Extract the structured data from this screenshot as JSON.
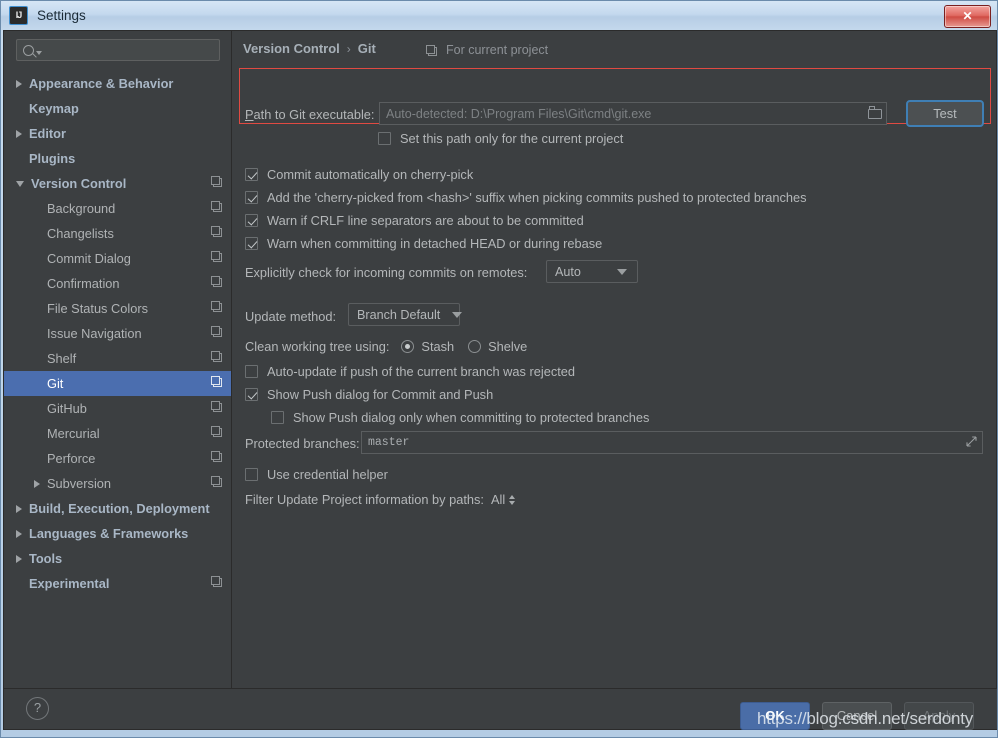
{
  "window": {
    "title": "Settings",
    "app_icon": "IJ",
    "close_label": "✕"
  },
  "sidebar": {
    "search": {
      "value": "",
      "placeholder": ""
    },
    "items": [
      {
        "label": "Appearance & Behavior",
        "level": 0,
        "arrow": "closed",
        "copy": false,
        "selected": false
      },
      {
        "label": "Keymap",
        "level": 0,
        "arrow": "none",
        "copy": false,
        "selected": false
      },
      {
        "label": "Editor",
        "level": 0,
        "arrow": "closed",
        "copy": false,
        "selected": false
      },
      {
        "label": "Plugins",
        "level": 0,
        "arrow": "none",
        "copy": false,
        "selected": false
      },
      {
        "label": "Version Control",
        "level": 0,
        "arrow": "open",
        "copy": true,
        "selected": false
      },
      {
        "label": "Background",
        "level": 1,
        "arrow": "none",
        "copy": true,
        "selected": false
      },
      {
        "label": "Changelists",
        "level": 1,
        "arrow": "none",
        "copy": true,
        "selected": false
      },
      {
        "label": "Commit Dialog",
        "level": 1,
        "arrow": "none",
        "copy": true,
        "selected": false
      },
      {
        "label": "Confirmation",
        "level": 1,
        "arrow": "none",
        "copy": true,
        "selected": false
      },
      {
        "label": "File Status Colors",
        "level": 1,
        "arrow": "none",
        "copy": true,
        "selected": false
      },
      {
        "label": "Issue Navigation",
        "level": 1,
        "arrow": "none",
        "copy": true,
        "selected": false
      },
      {
        "label": "Shelf",
        "level": 1,
        "arrow": "none",
        "copy": true,
        "selected": false
      },
      {
        "label": "Git",
        "level": 1,
        "arrow": "none",
        "copy": true,
        "selected": true
      },
      {
        "label": "GitHub",
        "level": 1,
        "arrow": "none",
        "copy": true,
        "selected": false
      },
      {
        "label": "Mercurial",
        "level": 1,
        "arrow": "none",
        "copy": true,
        "selected": false
      },
      {
        "label": "Perforce",
        "level": 1,
        "arrow": "none",
        "copy": true,
        "selected": false
      },
      {
        "label": "Subversion",
        "level": 1,
        "arrow": "closed",
        "copy": true,
        "selected": false
      },
      {
        "label": "Build, Execution, Deployment",
        "level": 0,
        "arrow": "closed",
        "copy": false,
        "selected": false
      },
      {
        "label": "Languages & Frameworks",
        "level": 0,
        "arrow": "closed",
        "copy": false,
        "selected": false
      },
      {
        "label": "Tools",
        "level": 0,
        "arrow": "closed",
        "copy": false,
        "selected": false
      },
      {
        "label": "Experimental",
        "level": 0,
        "arrow": "none",
        "copy": true,
        "selected": false
      }
    ]
  },
  "breadcrumb": {
    "root": "Version Control",
    "separator": "›",
    "leaf": "Git",
    "scope": "For current project"
  },
  "git_settings": {
    "path_label": "Path to Git executable:",
    "path_value": "Auto-detected: D:\\Program Files\\Git\\cmd\\git.exe",
    "test_button": "Test",
    "set_path_only_label": "Set this path only for the current project",
    "set_path_only_checked": false,
    "checkboxes": [
      {
        "label": "Commit automatically on cherry-pick",
        "checked": true
      },
      {
        "label": "Add the 'cherry-picked from <hash>' suffix when picking commits pushed to protected branches",
        "checked": true
      },
      {
        "label": "Warn if CRLF line separators are about to be committed",
        "checked": true
      },
      {
        "label": "Warn when committing in detached HEAD or during rebase",
        "checked": true
      }
    ],
    "incoming_label": "Explicitly check for incoming commits on remotes:",
    "incoming_value": "Auto",
    "update_method_label": "Update method:",
    "update_method_value": "Branch Default",
    "clean_tree_label": "Clean working tree using:",
    "clean_tree_option_1": "Stash",
    "clean_tree_option_2": "Shelve",
    "clean_tree_selected": "Stash",
    "auto_update_label": "Auto-update if push of the current branch was rejected",
    "auto_update_checked": false,
    "show_push_label": "Show Push dialog for Commit and Push",
    "show_push_checked": true,
    "show_push_protected_label": "Show Push dialog only when committing to protected branches",
    "show_push_protected_checked": false,
    "protected_branches_label": "Protected branches:",
    "protected_branches_value": "master",
    "credential_helper_label": "Use credential helper",
    "credential_helper_checked": false,
    "filter_label": "Filter Update Project information by paths:",
    "filter_value": "All"
  },
  "footer": {
    "help": "?",
    "ok": "OK",
    "cancel": "Cancel",
    "apply": "Apply"
  },
  "watermark": "https://blog.csdn.net/serdonty",
  "colors": {
    "background": "#3c3f41",
    "selection": "#4b6eaf",
    "accent_button": "#4a6da7",
    "annotation": "#e04a42",
    "focus_ring": "#3f7fb5"
  }
}
